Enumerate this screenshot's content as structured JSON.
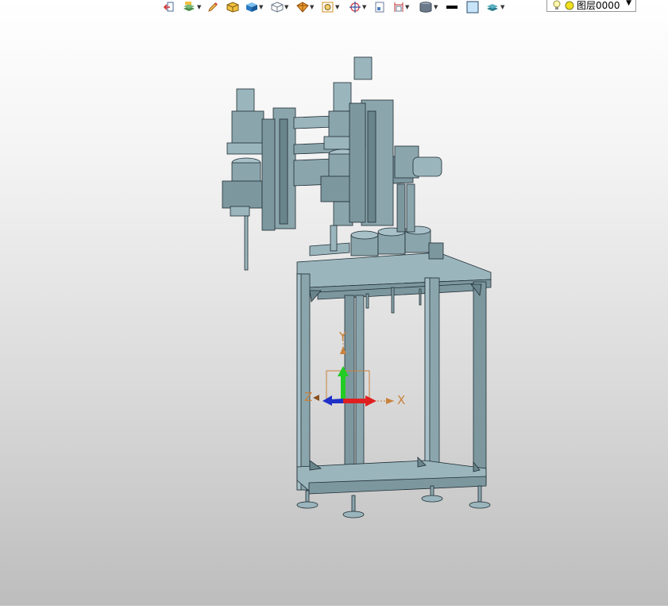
{
  "toolbar": {
    "layer_selector": {
      "value": "图层0000",
      "icons": [
        "lightbulb-icon",
        "sun-icon"
      ]
    },
    "buttons": [
      {
        "name": "exit-icon"
      },
      {
        "name": "layers-filter-icon",
        "dropdown": true
      },
      {
        "name": "pencil-icon"
      },
      {
        "name": "render-shaded-icon"
      },
      {
        "name": "cube-shaded-icon",
        "dropdown": true
      },
      {
        "name": "cube-wireframe-icon",
        "dropdown": true
      },
      {
        "name": "section-view-icon",
        "dropdown": true
      },
      {
        "name": "zoom-fit-icon",
        "dropdown": true
      },
      {
        "name": "target-icon",
        "dropdown": true
      },
      {
        "name": "page-icon"
      },
      {
        "name": "dimension-icon",
        "dropdown": true
      },
      {
        "name": "cylinder-icon",
        "dropdown": true
      },
      {
        "name": "line-color-icon"
      },
      {
        "name": "fill-color-icon"
      },
      {
        "name": "layer-stack-icon",
        "dropdown": true
      }
    ]
  },
  "viewport": {
    "model_color": "#8ba5ad",
    "model_edge_color": "#1e2d33",
    "triad": {
      "x_label": "X",
      "y_label": "Y",
      "z_label": "Z",
      "label_color": "#c8823c",
      "x_color": "#e02020",
      "y_color": "#22cc22",
      "z_color": "#2030c8"
    }
  }
}
